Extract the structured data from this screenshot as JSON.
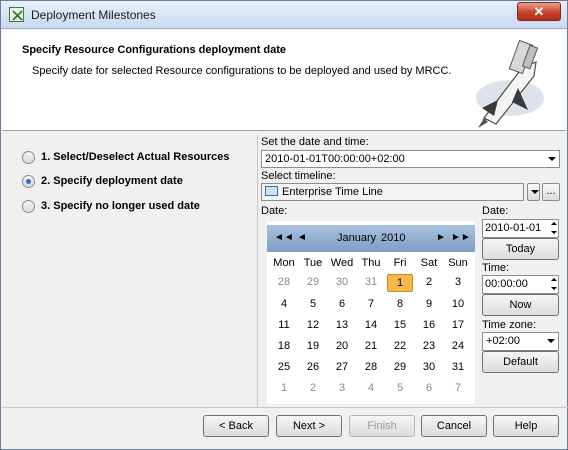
{
  "window": {
    "title": "Deployment Milestones",
    "close_label": "✕"
  },
  "header": {
    "title": "Specify Resource Configurations deployment date",
    "description": "Specify date for selected Resource configurations to be deployed and used by MRCC."
  },
  "steps": [
    {
      "label": "1. Select/Deselect Actual Resources",
      "selected": false
    },
    {
      "label": "2. Specify deployment date",
      "selected": true
    },
    {
      "label": "3. Specify no longer used date",
      "selected": false
    }
  ],
  "form": {
    "datetime_label": "Set the date and time:",
    "datetime_value": "2010-01-01T00:00:00+02:00",
    "timeline_label": "Select timeline:",
    "timeline_value": "Enterprise Time Line",
    "ellipsis_label": "...",
    "date_label": "Date:"
  },
  "calendar": {
    "nav": {
      "prev_year": "◄◄",
      "prev_month": "◄",
      "next_month": "►",
      "next_year": "►►"
    },
    "month": "January",
    "year": "2010",
    "weekdays": [
      "Mon",
      "Tue",
      "Wed",
      "Thu",
      "Fri",
      "Sat",
      "Sun"
    ],
    "weeks": [
      [
        "28",
        "29",
        "30",
        "31",
        "1",
        "2",
        "3"
      ],
      [
        "4",
        "5",
        "6",
        "7",
        "8",
        "9",
        "10"
      ],
      [
        "11",
        "12",
        "13",
        "14",
        "15",
        "16",
        "17"
      ],
      [
        "18",
        "19",
        "20",
        "21",
        "22",
        "23",
        "24"
      ],
      [
        "25",
        "26",
        "27",
        "28",
        "29",
        "30",
        "31"
      ],
      [
        "1",
        "2",
        "3",
        "4",
        "5",
        "6",
        "7"
      ]
    ],
    "selected_day": "1"
  },
  "side": {
    "date_label": "Date:",
    "date_value": "2010-01-01",
    "today_label": "Today",
    "time_label": "Time:",
    "time_value": "00:00:00",
    "now_label": "Now",
    "timezone_label": "Time zone:",
    "timezone_value": "+02:00",
    "default_label": "Default"
  },
  "buttons": {
    "back": "< Back",
    "next": "Next >",
    "finish": "Finish",
    "cancel": "Cancel",
    "help": "Help"
  },
  "colors": {
    "accent": "#2d6cc8",
    "selected_day": "#f6b94b",
    "calendar_header": "#8faacc",
    "close": "#c9422b"
  }
}
